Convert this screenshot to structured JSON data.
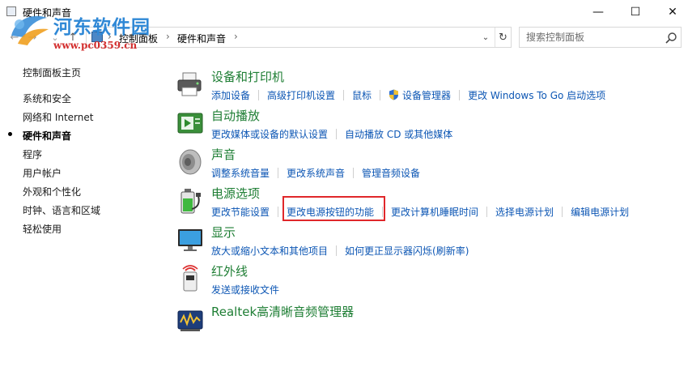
{
  "window": {
    "title": "硬件和声音",
    "minimize_glyph": "—",
    "maximize_glyph": "☐",
    "close_glyph": "✕"
  },
  "watermark": {
    "title": "河东软件园",
    "url": "www.pc0359.cn"
  },
  "address": {
    "crumbs": [
      "控制面板",
      "硬件和声音"
    ],
    "separator": "›",
    "back_glyph": "←",
    "forward_glyph": "→",
    "recent_glyph": "⌄",
    "up_glyph": "↑",
    "dropdown_glyph": "⌄",
    "refresh_glyph": "↻"
  },
  "search": {
    "placeholder": "搜索控制面板"
  },
  "leftnav": {
    "items": [
      {
        "label": "控制面板主页",
        "current": false
      },
      {
        "label": "系统和安全",
        "current": false
      },
      {
        "label": "网络和 Internet",
        "current": false
      },
      {
        "label": "硬件和声音",
        "current": true
      },
      {
        "label": "程序",
        "current": false
      },
      {
        "label": "用户帐户",
        "current": false
      },
      {
        "label": "外观和个性化",
        "current": false
      },
      {
        "label": "时钟、语言和区域",
        "current": false
      },
      {
        "label": "轻松使用",
        "current": false
      }
    ]
  },
  "categories": [
    {
      "title": "设备和打印机",
      "icon": "printer-icon",
      "links": [
        "添加设备",
        "高级打印机设置",
        "鼠标",
        "设备管理器",
        "更改 Windows To Go 启动选项"
      ]
    },
    {
      "title": "自动播放",
      "icon": "autoplay-icon",
      "links": [
        "更改媒体或设备的默认设置",
        "自动播放 CD 或其他媒体"
      ]
    },
    {
      "title": "声音",
      "icon": "speaker-icon",
      "links": [
        "调整系统音量",
        "更改系统声音",
        "管理音频设备"
      ]
    },
    {
      "title": "电源选项",
      "icon": "battery-icon",
      "links": [
        "更改节能设置",
        "更改电源按钮的功能",
        "更改计算机睡眠时间",
        "选择电源计划",
        "编辑电源计划"
      ]
    },
    {
      "title": "显示",
      "icon": "monitor-icon",
      "links": [
        "放大或缩小文本和其他项目",
        "如何更正显示器闪烁(刷新率)"
      ]
    },
    {
      "title": "红外线",
      "icon": "infrared-icon",
      "links": [
        "发送或接收文件"
      ]
    },
    {
      "title": "Realtek高清晰音频管理器",
      "icon": "realtek-audio-icon",
      "links": []
    }
  ],
  "colors": {
    "category_title": "#1e7e34",
    "link": "#0c56b4",
    "highlight_box": "#e0272a",
    "watermark_title": "#2f88d6",
    "watermark_url": "#d32f2f"
  }
}
